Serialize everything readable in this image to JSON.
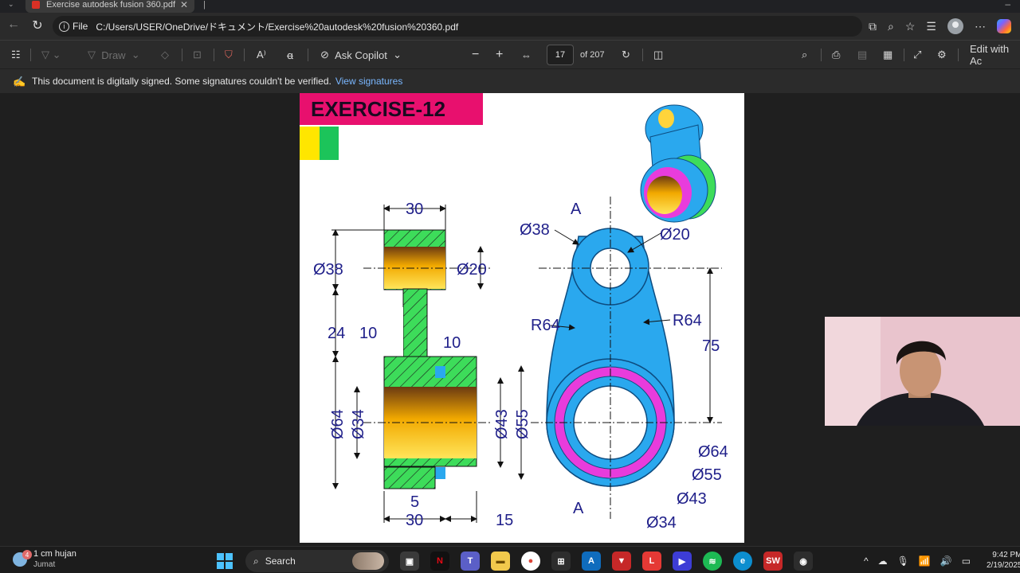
{
  "browser": {
    "tab_title": "Exercise autodesk fusion 360.pdf",
    "scheme_label": "File",
    "url": "C:/Users/USER/OneDrive/ドキュメント/Exercise%20autodesk%20fusion%20360.pdf",
    "icons": [
      "back-icon",
      "reload-icon",
      "info-icon",
      "read-aloud-icon",
      "zoom-icon",
      "favorite-icon",
      "collections-icon",
      "profile-icon",
      "more-icon",
      "copilot-icon"
    ]
  },
  "pdf_toolbar": {
    "draw_label": "Draw",
    "ask_copilot_label": "Ask Copilot",
    "zoom_out": "−",
    "zoom_in": "+",
    "page_number": "17",
    "page_total": "of 207",
    "edit_label": "Edit with Ac"
  },
  "signature_bar": {
    "message": "This document is digitally signed. Some signatures couldn't be verified.",
    "link": "View signatures"
  },
  "drawing": {
    "title": "EXERCISE-12",
    "dim_30_top": "30",
    "dim_d38_left": "Ø38",
    "dim_d20_left": "Ø20",
    "dim_24": "24",
    "dim_10a": "10",
    "dim_10b": "10",
    "dim_d64_left": "Ø64",
    "dim_d34_left": "Ø34",
    "dim_d43_left": "Ø43",
    "dim_d55_left": "Ø55",
    "dim_5": "5",
    "dim_30_bottom": "30",
    "dim_15": "15",
    "label_a_top": "A",
    "label_a_bottom": "A",
    "dim_d38_right": "Ø38",
    "dim_d20_right": "Ø20",
    "dim_r64_left": "R64",
    "dim_r64_right": "R64",
    "dim_75": "75",
    "dim_d64_right": "Ø64",
    "dim_d55_right": "Ø55",
    "dim_d43_right": "Ø43",
    "dim_d34_right": "Ø34"
  },
  "colors": {
    "title_bg": "#e8106e",
    "section_hatch": "#3ddc5a",
    "bore": "#f5c400",
    "part_blue": "#2aa8ee",
    "ring_magenta": "#e83cdc",
    "dimension_text": "#20208a"
  },
  "taskbar": {
    "weather_badge": "4",
    "weather_main": "1 cm hujan",
    "weather_sub": "Jumat",
    "search_label": "Search",
    "clock_time": "9:42 PM",
    "clock_date": "2/19/2025"
  }
}
